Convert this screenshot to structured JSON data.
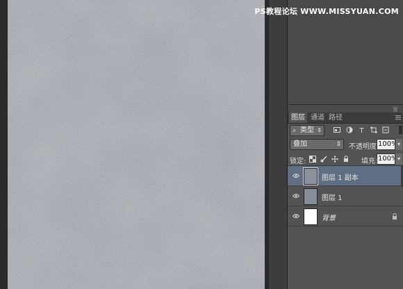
{
  "watermark": {
    "prefix": "PS",
    "text": "教程论坛 WWW.MISSYUAN.COM"
  },
  "layers_panel": {
    "tabs": [
      "图层",
      "通道",
      "路径"
    ],
    "filter": {
      "icon": "search-icon",
      "value": "类型"
    },
    "blend_mode": "叠加",
    "opacity_label": "不透明度:",
    "opacity_value": "100%",
    "lock_label": "锁定:",
    "fill_label": "填充:",
    "fill_value": "100%",
    "layers": [
      {
        "name": "图层 1 副本",
        "selected": true,
        "visible": true
      },
      {
        "name": "图层 1",
        "selected": false,
        "visible": true
      },
      {
        "name": "背景",
        "selected": false,
        "visible": true,
        "locked": true
      }
    ]
  },
  "colors": {
    "canvas_texture": "#8f97a5",
    "selected_row": "#5f6e82",
    "panel_bg": "#535353"
  }
}
